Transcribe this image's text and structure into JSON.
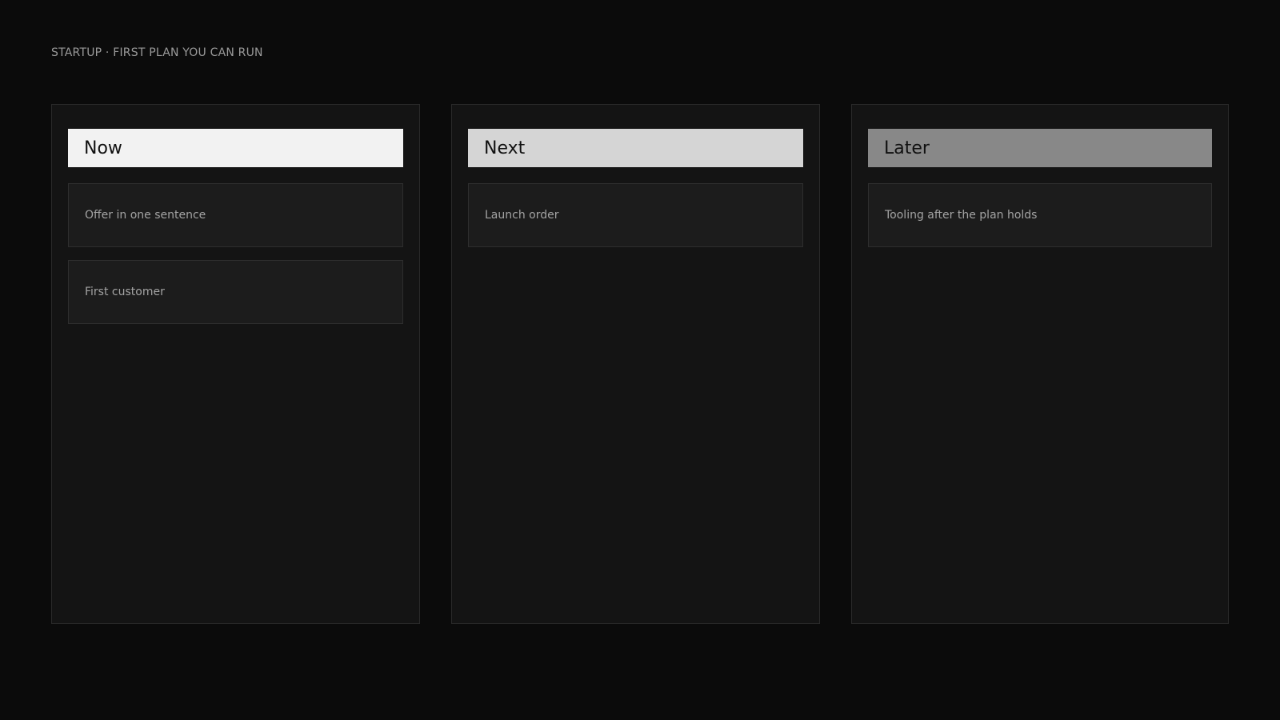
{
  "page": {
    "label": "STARTUP · FIRST PLAN YOU CAN RUN"
  },
  "columns": [
    {
      "title": "Now",
      "header_color": "#f2f2f2",
      "cards": [
        "Offer in one sentence",
        "First customer"
      ]
    },
    {
      "title": "Next",
      "header_color": "#d5d5d5",
      "cards": [
        "Launch order"
      ]
    },
    {
      "title": "Later",
      "header_color": "#888888",
      "cards": [
        "Tooling after the plan holds"
      ]
    }
  ]
}
